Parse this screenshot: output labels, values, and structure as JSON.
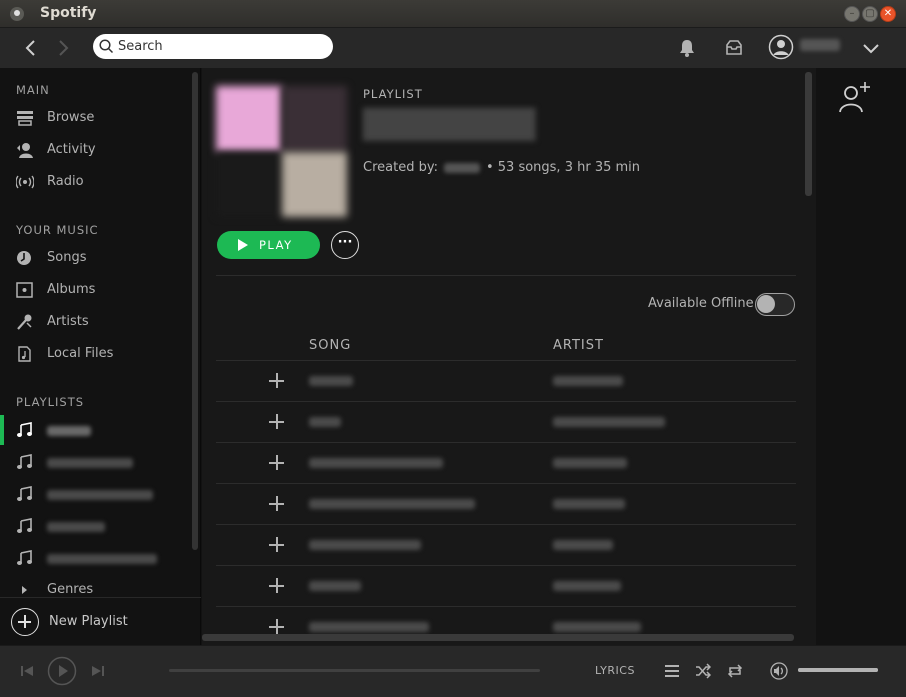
{
  "window": {
    "title": "Spotify"
  },
  "search": {
    "placeholder": "Search"
  },
  "sidebar": {
    "main_heading": "MAIN",
    "main_items": [
      {
        "label": "Browse",
        "icon": "browse-icon"
      },
      {
        "label": "Activity",
        "icon": "activity-icon"
      },
      {
        "label": "Radio",
        "icon": "radio-icon"
      }
    ],
    "music_heading": "YOUR MUSIC",
    "music_items": [
      {
        "label": "Songs",
        "icon": "songs-icon"
      },
      {
        "label": "Albums",
        "icon": "albums-icon"
      },
      {
        "label": "Artists",
        "icon": "artists-icon"
      },
      {
        "label": "Local Files",
        "icon": "local-files-icon"
      }
    ],
    "playlists_heading": "PLAYLISTS",
    "genres_label": "Genres",
    "new_playlist_label": "New Playlist"
  },
  "playlist": {
    "type_label": "PLAYLIST",
    "created_by_label": "Created by:",
    "stats": "• 53 songs, 3 hr 35 min",
    "play_label": "PLAY",
    "more_label": "···",
    "offline_label": "Available Offline",
    "offline_enabled": false,
    "song_header": "SONG",
    "artist_header": "ARTIST"
  },
  "player": {
    "lyrics_label": "LYRICS",
    "progress": 0,
    "volume": 1.0
  },
  "colors": {
    "accent": "#1db954",
    "background": "#121212",
    "panel": "#181818",
    "bar": "#282828"
  }
}
